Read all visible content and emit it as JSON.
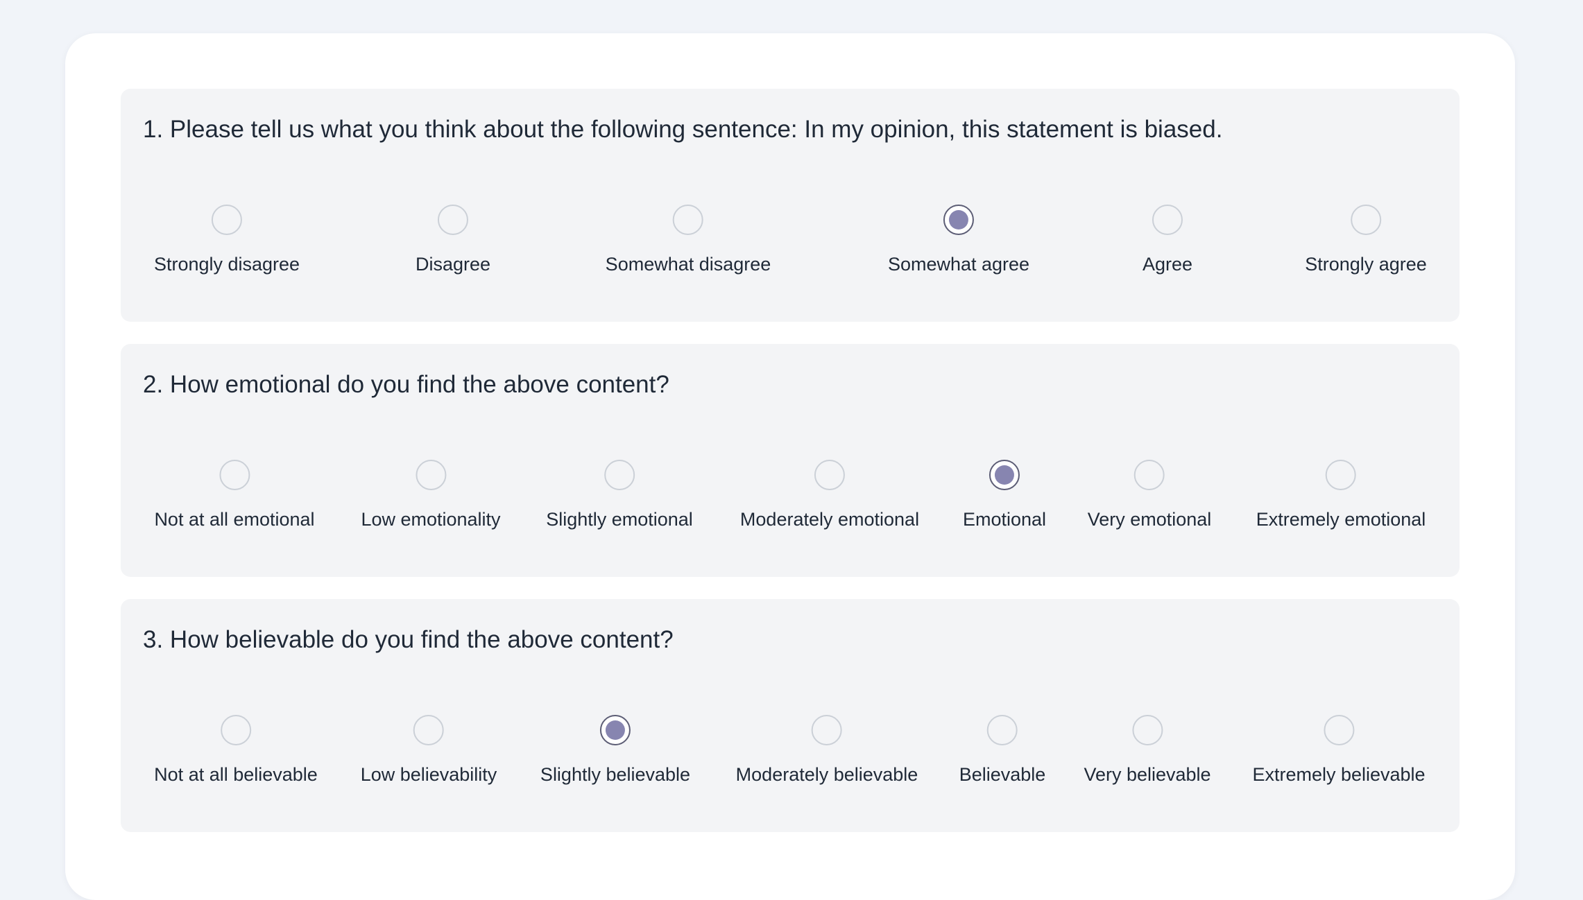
{
  "colors": {
    "page_background": "#f1f4f9",
    "card_background": "#ffffff",
    "question_background": "#f3f4f6",
    "selected_dot": "#8785b0",
    "selected_ring": "#5c5d75",
    "unselected_ring": "#cbd0d7",
    "text": "#1f2937"
  },
  "questions": [
    {
      "title": "1. Please tell us what you think about the following sentence: In my opinion, this statement is biased.",
      "selected_index": 3,
      "options": [
        {
          "label": "Strongly disagree"
        },
        {
          "label": "Disagree"
        },
        {
          "label": "Somewhat disagree"
        },
        {
          "label": "Somewhat agree"
        },
        {
          "label": "Agree"
        },
        {
          "label": "Strongly agree"
        }
      ]
    },
    {
      "title": "2. How emotional do you find the above content?",
      "selected_index": 4,
      "options": [
        {
          "label": "Not at all emotional"
        },
        {
          "label": "Low emotionality"
        },
        {
          "label": "Slightly emotional"
        },
        {
          "label": "Moderately emotional"
        },
        {
          "label": "Emotional"
        },
        {
          "label": "Very emotional"
        },
        {
          "label": "Extremely emotional"
        }
      ]
    },
    {
      "title": "3. How believable do you find the above content?",
      "selected_index": 2,
      "options": [
        {
          "label": "Not at all believable"
        },
        {
          "label": "Low believability"
        },
        {
          "label": "Slightly believable"
        },
        {
          "label": "Moderately believable"
        },
        {
          "label": "Believable"
        },
        {
          "label": "Very believable"
        },
        {
          "label": "Extremely believable"
        }
      ]
    }
  ]
}
